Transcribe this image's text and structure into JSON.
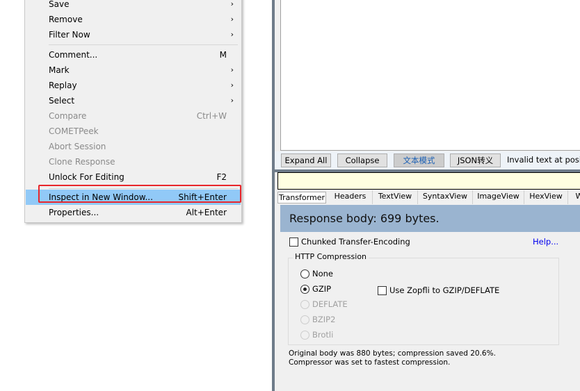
{
  "context_menu": {
    "items": [
      {
        "label": "Save",
        "shortcut": "",
        "submenu": true,
        "disabled": false
      },
      {
        "label": "Remove",
        "shortcut": "",
        "submenu": true,
        "disabled": false
      },
      {
        "label": "Filter Now",
        "shortcut": "",
        "submenu": true,
        "disabled": false
      },
      {
        "label": "Comment...",
        "shortcut": "M",
        "submenu": false,
        "disabled": false
      },
      {
        "label": "Mark",
        "shortcut": "",
        "submenu": true,
        "disabled": false
      },
      {
        "label": "Replay",
        "shortcut": "",
        "submenu": true,
        "disabled": false
      },
      {
        "label": "Select",
        "shortcut": "",
        "submenu": true,
        "disabled": false
      },
      {
        "label": "Compare",
        "shortcut": "Ctrl+W",
        "submenu": false,
        "disabled": true
      },
      {
        "label": "COMETPeek",
        "shortcut": "",
        "submenu": false,
        "disabled": true
      },
      {
        "label": "Abort Session",
        "shortcut": "",
        "submenu": false,
        "disabled": true
      },
      {
        "label": "Clone Response",
        "shortcut": "",
        "submenu": false,
        "disabled": true
      },
      {
        "label": "Unlock For Editing",
        "shortcut": "F2",
        "submenu": false,
        "disabled": false
      },
      {
        "label": "Inspect in New Window...",
        "shortcut": "Shift+Enter",
        "submenu": false,
        "disabled": false,
        "highlighted": true
      },
      {
        "label": "Properties...",
        "shortcut": "Alt+Enter",
        "submenu": false,
        "disabled": false
      }
    ],
    "highlight_color": "#91c9f7",
    "annotation_color": "#e8262b"
  },
  "toolbar": {
    "buttons": [
      "Expand All",
      "Collapse",
      "文本模式",
      "JSON转义"
    ],
    "status": "Invalid text at positio"
  },
  "tabs": [
    "Transformer",
    "Headers",
    "TextView",
    "SyntaxView",
    "ImageView",
    "HexView",
    "W"
  ],
  "transformer": {
    "band": "Response body: 699 bytes.",
    "chunked_label": "Chunked Transfer-Encoding",
    "chunked_checked": false,
    "help": "Help...",
    "group_title": "HTTP Compression",
    "options": [
      {
        "label": "None",
        "selected": false,
        "disabled": false
      },
      {
        "label": "GZIP",
        "selected": true,
        "disabled": false
      },
      {
        "label": "DEFLATE",
        "selected": false,
        "disabled": true
      },
      {
        "label": "BZIP2",
        "selected": false,
        "disabled": true
      },
      {
        "label": "Brotli",
        "selected": false,
        "disabled": true
      }
    ],
    "zopfli_label": "Use Zopfli to GZIP/DEFLATE",
    "zopfli_checked": false,
    "note1": "Original body was 880 bytes; compression saved 20.6%.",
    "note2": "Compressor was set to fastest compression."
  }
}
